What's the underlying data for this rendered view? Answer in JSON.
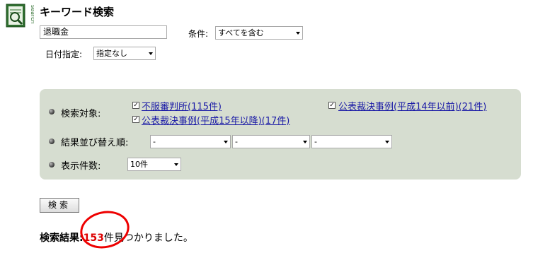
{
  "header": {
    "logo_text": "search",
    "title": "キーワード検索"
  },
  "keyword": {
    "value": "退職金"
  },
  "condition": {
    "label": "条件:",
    "value": "すべてを含む"
  },
  "date": {
    "label": "日付指定:",
    "value": "指定なし"
  },
  "panel": {
    "targets_label": "検索対象:",
    "targets": [
      {
        "label": "不服審判所(115件)",
        "checked": true
      },
      {
        "label": "公表裁決事例(平成14年以前)(21件)",
        "checked": true
      },
      {
        "label": "公表裁決事例(平成15年以降)(17件)",
        "checked": true
      }
    ],
    "sort_label": "結果並び替え順:",
    "sort_options": [
      "-",
      "-",
      "-"
    ],
    "count_label": "表示件数:",
    "count_value": "10件"
  },
  "search_button": {
    "label": "検索"
  },
  "result": {
    "prefix": "検索結果:",
    "count": "153",
    "suffix": "件見つかりました。"
  },
  "colors": {
    "panel_bg": "#d6ddd0",
    "link": "#1a1aa6",
    "highlight": "#dd0000"
  }
}
